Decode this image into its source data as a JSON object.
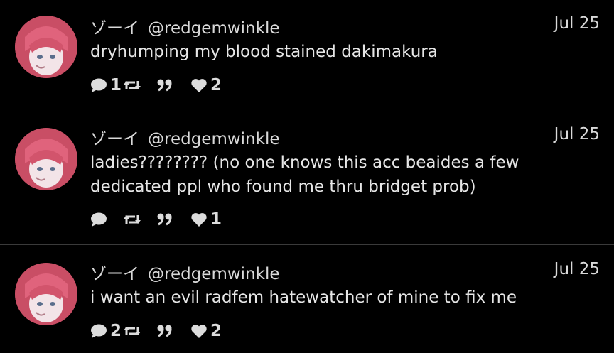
{
  "posts": [
    {
      "display_name": "ゾーイ",
      "handle": "@redgemwinkle",
      "date": "Jul 25",
      "text_lines": [
        "dryhumping my blood stained dakimakura"
      ],
      "replies": "1",
      "reposts": "",
      "quotes": "",
      "likes": "2"
    },
    {
      "display_name": "ゾーイ",
      "handle": "@redgemwinkle",
      "date": "Jul 25",
      "text_lines": [
        "ladies???????? (no one knows this acc beaides a few",
        "dedicated ppl who found me thru bridget prob)"
      ],
      "replies": "",
      "reposts": "",
      "quotes": "",
      "likes": "1"
    },
    {
      "display_name": "ゾーイ",
      "handle": "@redgemwinkle",
      "date": "Jul 25",
      "text_lines": [
        "i want an evil radfem hatewatcher of mine to fix me"
      ],
      "replies": "2",
      "reposts": "",
      "quotes": "",
      "likes": "2"
    }
  ],
  "icons": {
    "reply": "speech-bubble-icon",
    "repost": "repost-arrows-icon",
    "quote": "quote-marks-icon",
    "like": "heart-icon"
  },
  "colors": {
    "background": "#000000",
    "text": "#d9d9d9",
    "divider": "#3a3a3a",
    "avatar_hair": "#c94e65"
  }
}
